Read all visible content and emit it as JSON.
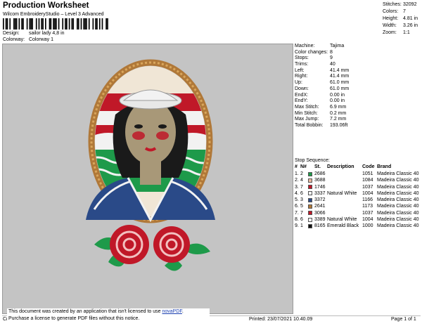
{
  "header": {
    "title": "Production Worksheet",
    "subtitle": "Wilcom EmbroideryStudio – Level 3 Advanced",
    "design_label": "Design:",
    "design_value": "sailor lady 4,8 in",
    "colorway_label": "Colorway:",
    "colorway_value": "Colorway 1"
  },
  "stats": [
    {
      "label": "Stitches:",
      "value": "32092"
    },
    {
      "label": "Colors:",
      "value": "7"
    },
    {
      "label": "Height:",
      "value": "4.81 in"
    },
    {
      "label": "Width:",
      "value": "3.26 in"
    },
    {
      "label": "Zoom:",
      "value": "1:1"
    }
  ],
  "properties": [
    {
      "label": "Machine:",
      "value": "Tajima"
    },
    {
      "label": "Color changes:",
      "value": "8"
    },
    {
      "label": "Stops:",
      "value": "9"
    },
    {
      "label": "Trims:",
      "value": "40"
    },
    {
      "label": "Left:",
      "value": "41.4 mm"
    },
    {
      "label": "Right:",
      "value": "41.4 mm"
    },
    {
      "label": "Up:",
      "value": "61.0 mm"
    },
    {
      "label": "Down:",
      "value": "61.0 mm"
    },
    {
      "label": "EndX:",
      "value": "0.00 in"
    },
    {
      "label": "EndY:",
      "value": "0.00 in"
    },
    {
      "label": "Max Stitch:",
      "value": "6.9 mm"
    },
    {
      "label": "Min Stitch:",
      "value": "0.2 mm"
    },
    {
      "label": "Max Jump:",
      "value": "7.2 mm"
    },
    {
      "label": "Total Bobbin:",
      "value": "193.06ft"
    }
  ],
  "sequence": {
    "title": "Stop Sequence:",
    "headers": {
      "n": "#",
      "no": "N#",
      "st": "St.",
      "desc": "Description",
      "code": "Code",
      "brand": "Brand"
    },
    "rows": [
      {
        "n": "1.",
        "no": "2",
        "color": "#1e9a4a",
        "st": "2686",
        "desc": "",
        "code": "1051",
        "brand": "Madeira Classic 40"
      },
      {
        "n": "2.",
        "no": "4",
        "color": "#e8b8a0",
        "st": "3688",
        "desc": "",
        "code": "1084",
        "brand": "Madeira Classic 40"
      },
      {
        "n": "3.",
        "no": "7",
        "color": "#c01828",
        "st": "1746",
        "desc": "",
        "code": "1037",
        "brand": "Madeira Classic 40"
      },
      {
        "n": "4.",
        "no": "6",
        "color": "#f2f2f2",
        "st": "3337",
        "desc": "Natural White",
        "code": "1004",
        "brand": "Madeira Classic 40"
      },
      {
        "n": "5.",
        "no": "3",
        "color": "#2a4a88",
        "st": "3372",
        "desc": "",
        "code": "1166",
        "brand": "Madeira Classic 40"
      },
      {
        "n": "6.",
        "no": "5",
        "color": "#b07838",
        "st": "2641",
        "desc": "",
        "code": "1173",
        "brand": "Madeira Classic 40"
      },
      {
        "n": "7.",
        "no": "7",
        "color": "#c01828",
        "st": "3066",
        "desc": "",
        "code": "1037",
        "brand": "Madeira Classic 40"
      },
      {
        "n": "8.",
        "no": "6",
        "color": "#f2f2f2",
        "st": "3389",
        "desc": "Natural White",
        "code": "1004",
        "brand": "Madeira Classic 40"
      },
      {
        "n": "9.",
        "no": "1",
        "color": "#111111",
        "st": "8165",
        "desc": "Emerald Black",
        "code": "1000",
        "brand": "Madeira Classic 40"
      }
    ]
  },
  "footer": {
    "note_line1": "This document was created by an application that isn't licensed to use ",
    "note_link": "novaPDF",
    "note_line1_end": ".",
    "note_line2": "Purchase a license to generate PDF files without this notice.",
    "cr": "Cr",
    "printed": "Printed: 23/07/2021 10.40.09",
    "page": "Page 1 of 1"
  },
  "colors": {
    "preview_bg": "#c4c4c4",
    "link": "#1a3fb0"
  }
}
